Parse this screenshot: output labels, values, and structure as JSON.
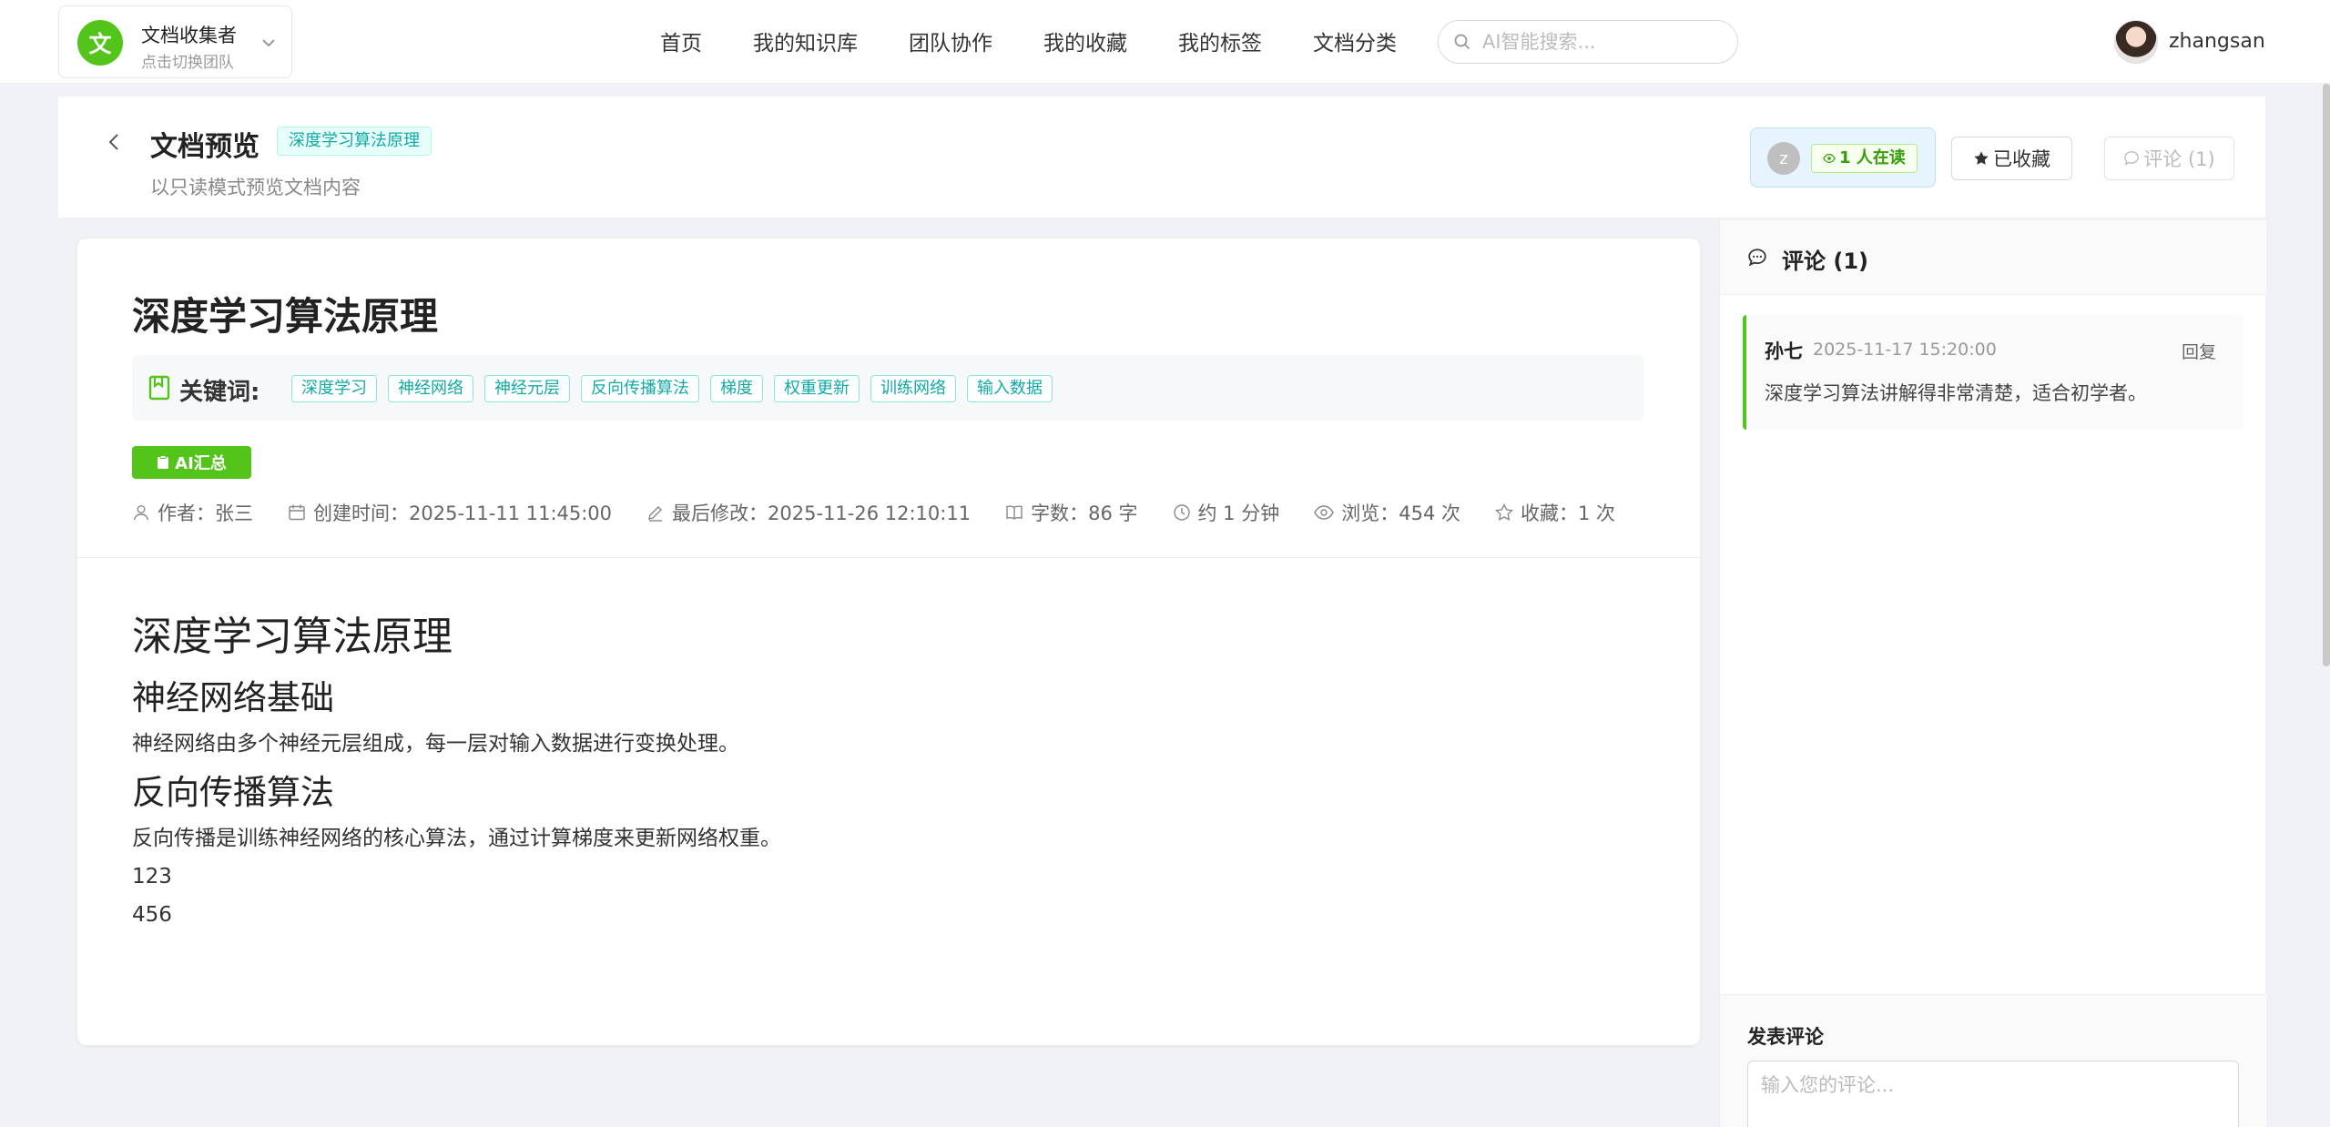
{
  "team": {
    "logo_char": "文",
    "name": "文档收集者",
    "subtitle": "点击切换团队"
  },
  "nav": [
    "首页",
    "我的知识库",
    "团队协作",
    "我的收藏",
    "我的标签",
    "文档分类"
  ],
  "search": {
    "placeholder": "AI智能搜索..."
  },
  "user": {
    "name": "zhangsan"
  },
  "header": {
    "title": "文档预览",
    "tag": "深度学习算法原理",
    "subtitle": "以只读模式预览文档内容",
    "reader_initial": "z",
    "readers_label": "1 人在读",
    "favorite_label": "已收藏",
    "comment_label": "评论 (1)"
  },
  "doc": {
    "title": "深度学习算法原理",
    "keywords_label": "关键词:",
    "keywords": [
      "深度学习",
      "神经网络",
      "神经元层",
      "反向传播算法",
      "梯度",
      "权重更新",
      "训练网络",
      "输入数据"
    ],
    "ai_summary_label": "AI汇总",
    "meta": {
      "author": "作者：张三",
      "created": "创建时间：2025-11-11 11:45:00",
      "modified": "最后修改：2025-11-26 12:10:11",
      "words": "字数：86 字",
      "read_time": "约 1 分钟",
      "views": "浏览：454 次",
      "favorites": "收藏：1 次"
    },
    "content": {
      "h1": "深度学习算法原理",
      "h2_a": "神经网络基础",
      "p_a": "神经网络由多个神经元层组成，每一层对输入数据进行变换处理。",
      "h2_b": "反向传播算法",
      "p_b": "反向传播是训练神经网络的核心算法，通过计算梯度来更新网络权重。",
      "p_c": "123",
      "p_d": "456"
    }
  },
  "comments": {
    "title": "评论 (1)",
    "items": [
      {
        "author": "孙七",
        "time": "2025-11-17 15:20:00",
        "reply": "回复",
        "text": "深度学习算法讲解得非常清楚，适合初学者。"
      }
    ],
    "post_label": "发表评论",
    "placeholder": "输入您的评论..."
  },
  "colors": {
    "primary": "#52c41a",
    "tag_cyan": "#13a8a8",
    "info_blue": "#e6f4ff"
  }
}
